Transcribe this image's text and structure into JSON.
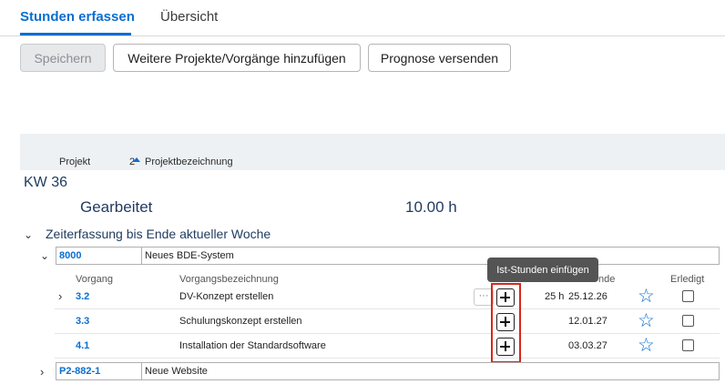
{
  "tabs": [
    {
      "label": "Stunden erfassen",
      "active": true
    },
    {
      "label": "Übersicht",
      "active": false
    }
  ],
  "toolbar": {
    "save_label": "Speichern",
    "add_label": "Weitere Projekte/Vorgänge hinzufügen",
    "forecast_label": "Prognose versenden"
  },
  "columns": {
    "project": "Projekt",
    "sort_index": "2",
    "project_desc": "Projektbezeichnung"
  },
  "week": {
    "label": "KW 36",
    "worked_label": "Gearbeitet",
    "worked_value": "10.00 h"
  },
  "section": {
    "title": "Zeiterfassung bis Ende aktueller Woche"
  },
  "projects": [
    {
      "id": "8000",
      "name": "Neues BDE-System"
    },
    {
      "id": "P2-882-1",
      "name": "Neue Website"
    }
  ],
  "sub_headers": {
    "vorgang": "Vorgang",
    "bezeichnung": "Vorgangsbezeichnung",
    "ende": "nde",
    "erledigt": "Erledigt"
  },
  "tasks": [
    {
      "vorgang": "3.2",
      "desc": "DV-Konzept erstellen",
      "dots": "···",
      "hours": "25 h",
      "date": "25.12.26"
    },
    {
      "vorgang": "3.3",
      "desc": "Schulungskonzept erstellen",
      "hours": "",
      "date": "12.01.27"
    },
    {
      "vorgang": "4.1",
      "desc": "Installation der Standardsoftware",
      "hours": "",
      "date": "03.03.27"
    }
  ],
  "tooltip": "Ist-Stunden einfügen",
  "colors": {
    "accent": "#0a6ed1",
    "highlight": "#d9261c",
    "tooltip_bg": "#545454"
  },
  "icons": [
    "chevron-down-icon",
    "chevron-right-icon",
    "sort-ascending-icon",
    "plus-icon",
    "star-icon",
    "checkbox-icon",
    "more-icon"
  ]
}
